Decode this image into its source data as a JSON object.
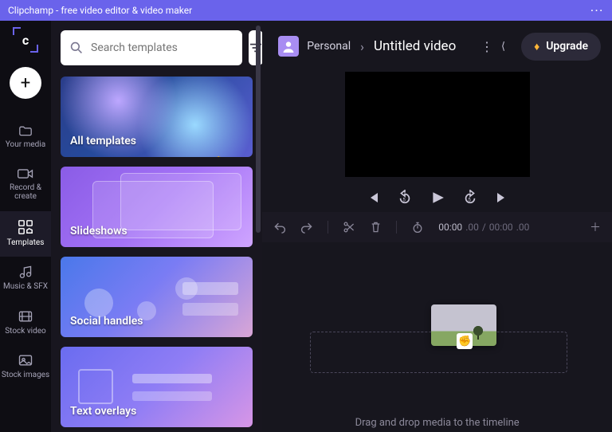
{
  "titlebar": {
    "title": "Clipchamp - free video editor & video maker"
  },
  "nav": {
    "items": [
      {
        "label": "Your media"
      },
      {
        "label": "Record & create"
      },
      {
        "label": "Templates"
      },
      {
        "label": "Music & SFX"
      },
      {
        "label": "Stock video"
      },
      {
        "label": "Stock images"
      }
    ]
  },
  "panel": {
    "search_placeholder": "Search templates",
    "categories": [
      {
        "label": "All templates"
      },
      {
        "label": "Slideshows"
      },
      {
        "label": "Social handles"
      },
      {
        "label": "Text overlays"
      }
    ]
  },
  "header": {
    "workspace": "Personal",
    "video_title": "Untitled video",
    "upgrade_label": "Upgrade"
  },
  "timeline": {
    "current_time": "00:00",
    "current_frames": ".00",
    "total_time": "00:00",
    "total_frames": ".00",
    "hint": "Drag and drop media to the timeline"
  }
}
